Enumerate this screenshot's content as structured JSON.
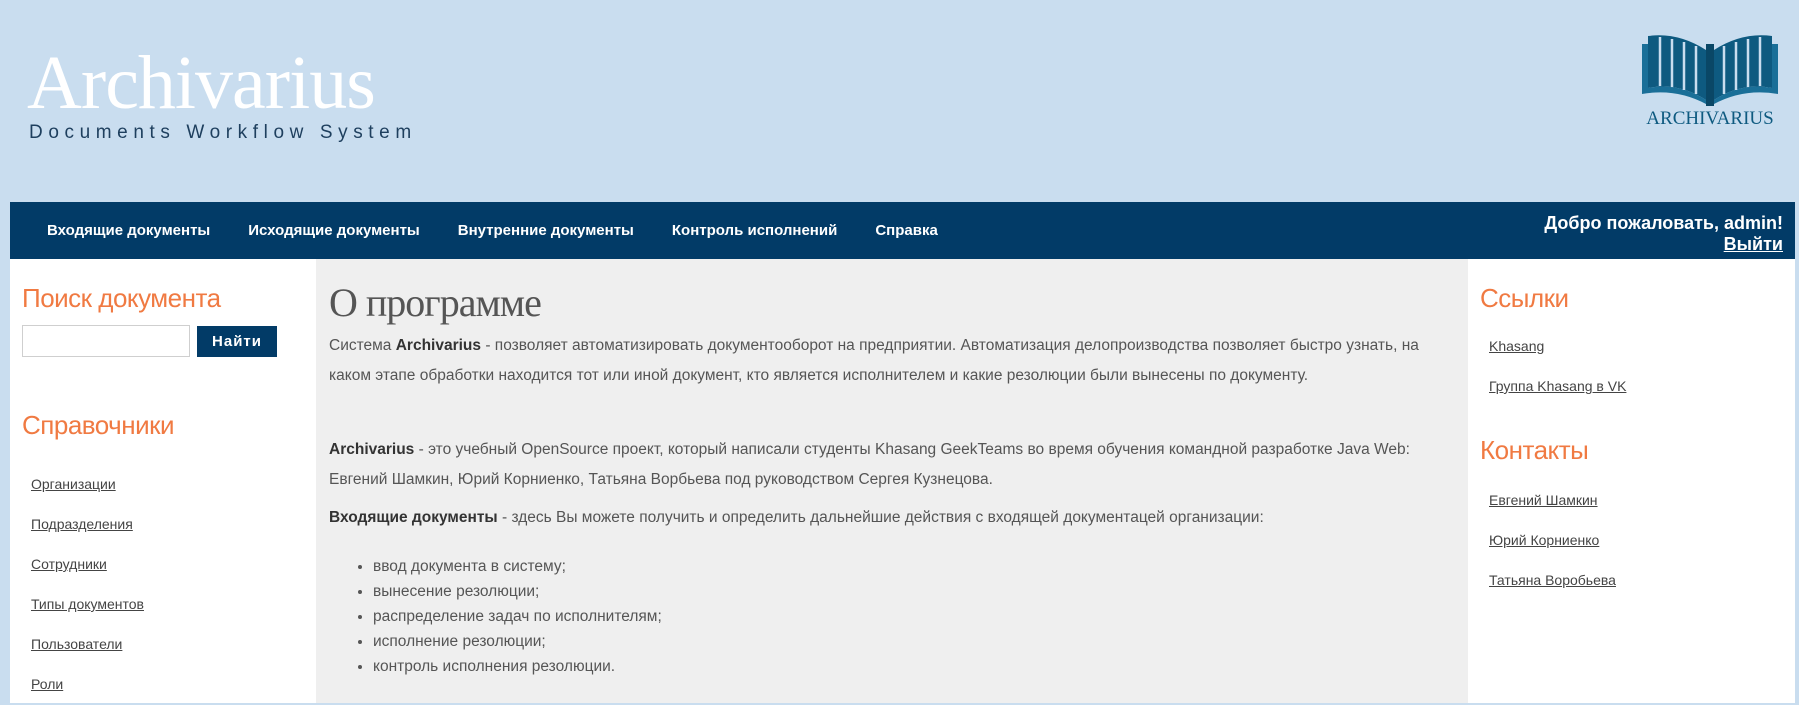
{
  "header": {
    "title": "Archivarius",
    "subtitle": "Documents Workflow System",
    "logo_caption": "ARCHIVARIUS"
  },
  "nav": {
    "items": [
      {
        "label": "Входящие документы"
      },
      {
        "label": "Исходящие документы"
      },
      {
        "label": "Внутренние документы"
      },
      {
        "label": "Контроль исполнений"
      },
      {
        "label": "Справка"
      }
    ],
    "welcome": "Добро пожаловать, admin!",
    "logout": "Выйти"
  },
  "left": {
    "search_heading": "Поиск документа",
    "search_value": "",
    "search_button": "Найти",
    "refs_heading": "Справочники",
    "refs": [
      {
        "label": "Организации"
      },
      {
        "label": "Подразделения"
      },
      {
        "label": "Сотрудники"
      },
      {
        "label": "Типы документов"
      },
      {
        "label": "Пользователи"
      },
      {
        "label": "Роли"
      }
    ]
  },
  "main": {
    "title": "О программе",
    "p1": {
      "prefix": "Система ",
      "bold": "Archivarius",
      "text": " - позволяет автоматизировать документооборот на предприятии. Автоматизация делопроизводства позволяет быстро узнать, на каком этапе обработки находится тот или иной документ, кто является исполнителем и какие резолюции были вынесены по документу."
    },
    "p2": {
      "bold": "Archivarius",
      "text": " - это учебный OpenSource проект, который написали студенты Khasang GeekTeams во время обучения командной разработке Java Web: Евгений Шамкин, Юрий Корниенко, Татьяна Ворбьева под руководством Сергея Кузнецова."
    },
    "p3": {
      "bold": "Входящие документы",
      "text": " - здесь Вы можете получить и определить дальнейшие действия с входящей документацей организации:"
    },
    "bullets": [
      "ввод документа в систему;",
      "вынесение резолюции;",
      "распределение задач по исполнителям;",
      "исполнение резолюции;",
      "контроль исполнения резолюции."
    ]
  },
  "right": {
    "links_heading": "Ссылки",
    "links": [
      {
        "label": "Khasang"
      },
      {
        "label": "Группа Khasang в VK"
      }
    ],
    "contacts_heading": "Контакты",
    "contacts": [
      {
        "label": "Евгений Шамкин"
      },
      {
        "label": "Юрий Корниенко"
      },
      {
        "label": "Татьяна Воробьева"
      }
    ]
  },
  "colors": {
    "page_bg": "#c9ddef",
    "navbar": "#023b67",
    "accent_heading": "#f07a42",
    "content_bg": "#efefef",
    "logo": "#0e5a80"
  },
  "icons": {
    "logo": "open-book-icon"
  }
}
